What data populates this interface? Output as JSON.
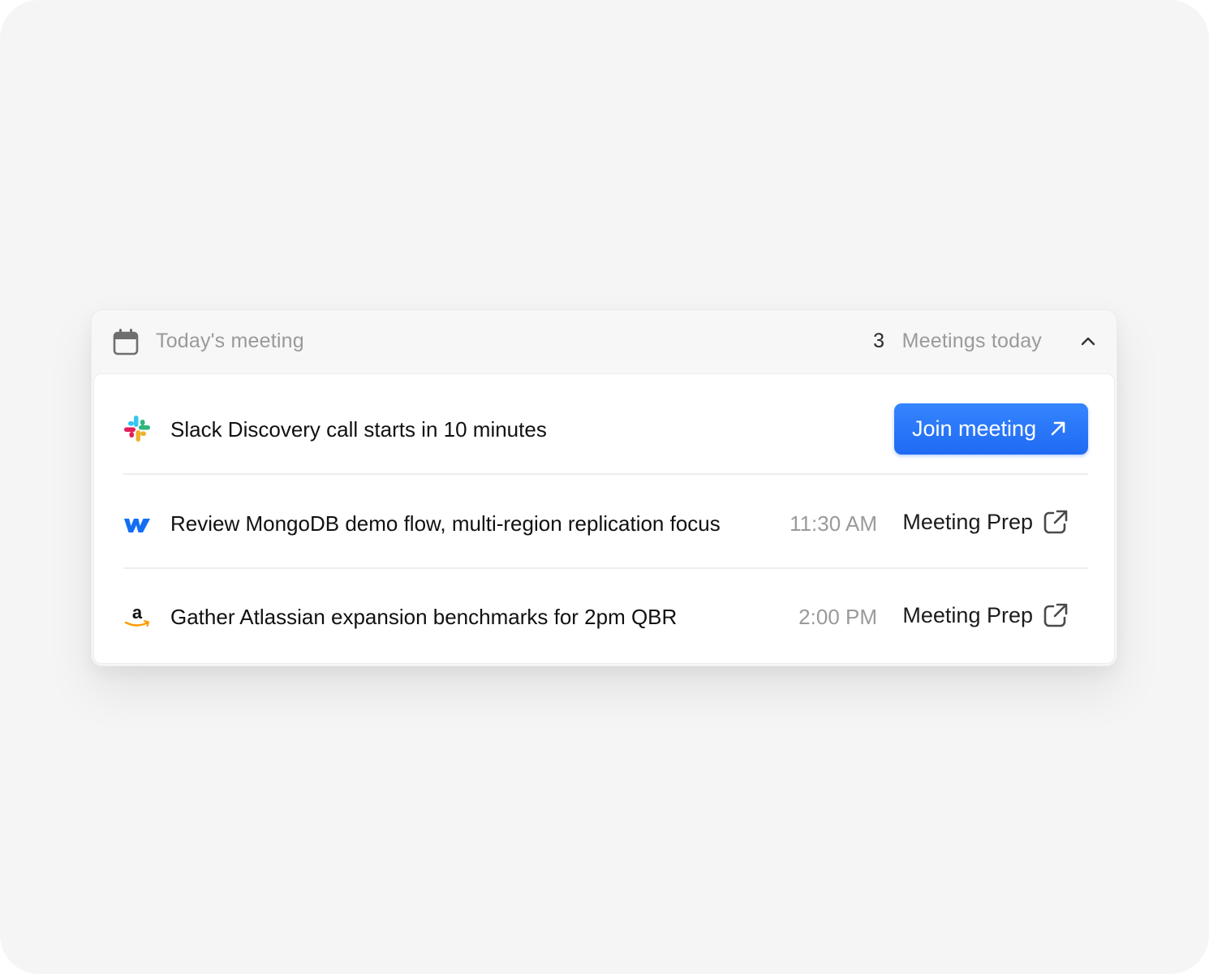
{
  "header": {
    "title": "Today's meeting",
    "count": "3",
    "count_label": "Meetings today",
    "icon": "calendar-icon",
    "toggle_icon": "chevron-up-icon"
  },
  "meetings": [
    {
      "logo": "slack-logo",
      "title": "Slack Discovery call starts in 10 minutes",
      "action_label": "Join meeting",
      "action_icon": "arrow-up-right-icon"
    },
    {
      "logo": "webflow-logo",
      "title": "Review MongoDB demo flow, multi-region replication focus",
      "time": "11:30 AM",
      "action_label": "Meeting Prep",
      "action_icon": "external-link-icon"
    },
    {
      "logo": "amazon-logo",
      "title": "Gather Atlassian expansion benchmarks for 2pm QBR",
      "time": "2:00 PM",
      "action_label": "Meeting Prep",
      "action_icon": "external-link-icon"
    }
  ],
  "colors": {
    "accent": "#1f6af3",
    "muted_text": "#9a9a9a",
    "primary_text": "#111111",
    "background": "#f5f5f5"
  }
}
